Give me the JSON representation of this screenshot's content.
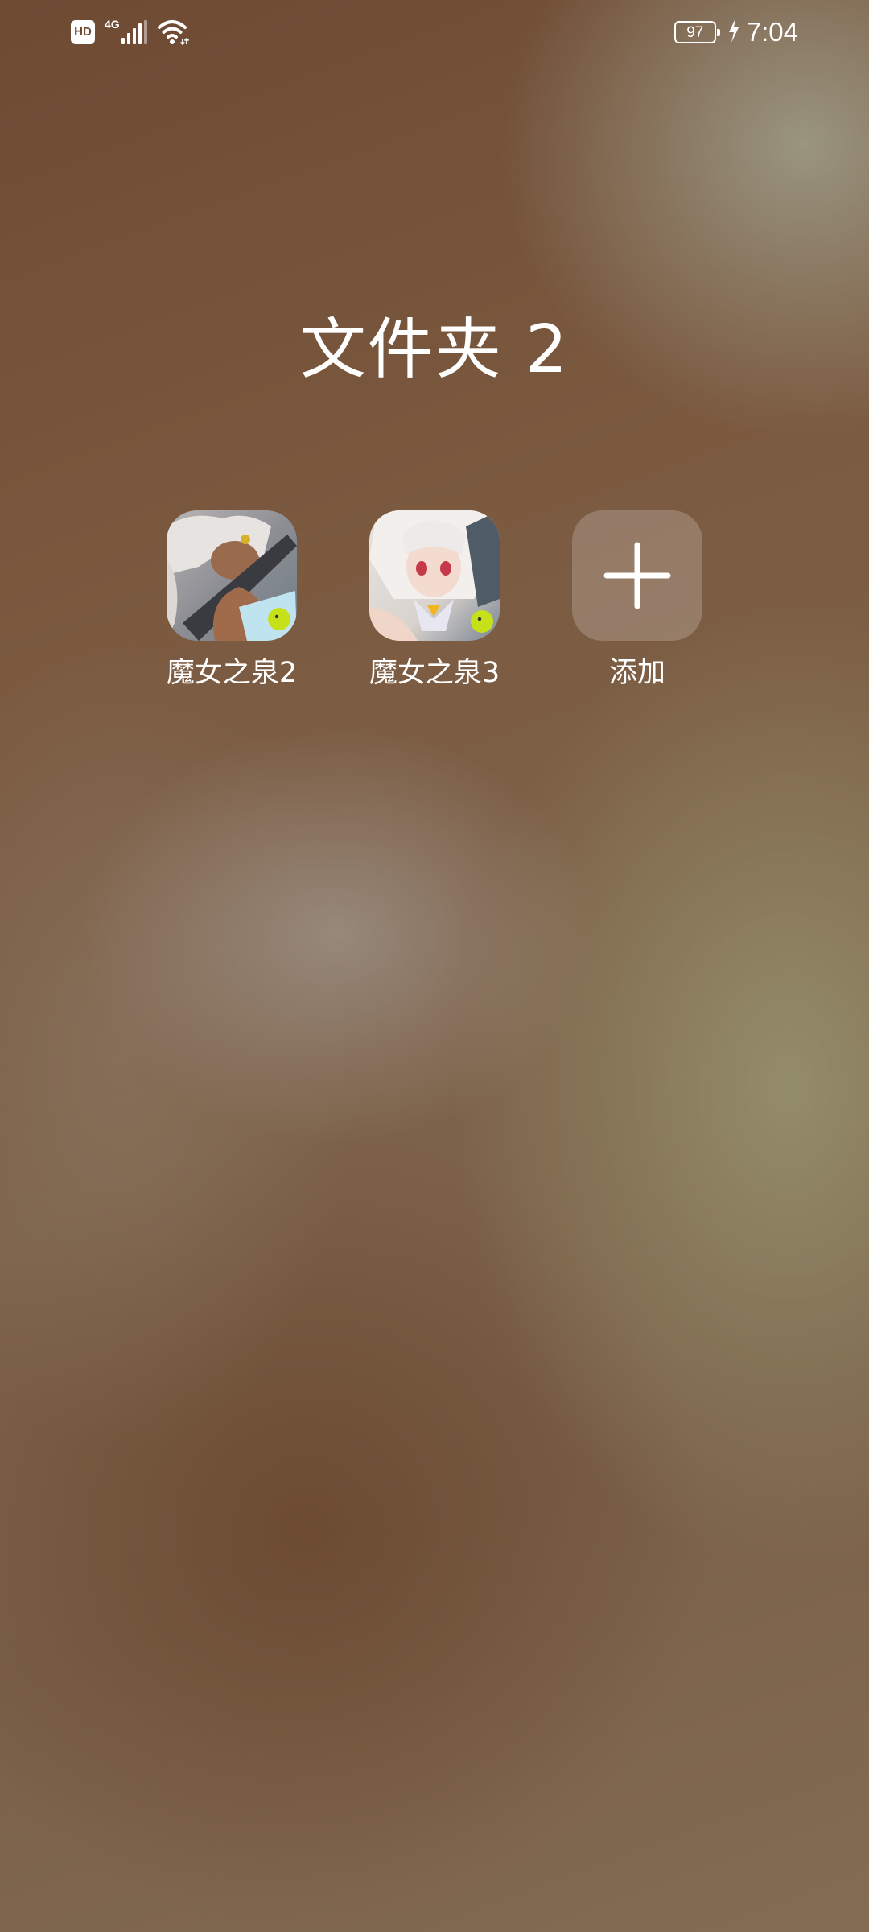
{
  "status_bar": {
    "hd_label": "HD",
    "network_type": "4G",
    "battery_level": "97",
    "time": "7:04",
    "icons": [
      "hd-icon",
      "signal-icon",
      "wifi-icon",
      "battery-icon",
      "charging-icon"
    ]
  },
  "folder": {
    "title": "文件夹 2",
    "apps": [
      {
        "label": "魔女之泉2",
        "icon": "game-icon-witch-spring-2"
      },
      {
        "label": "魔女之泉3",
        "icon": "game-icon-witch-spring-3"
      }
    ],
    "add_button": {
      "label": "添加",
      "icon": "plus-icon"
    }
  }
}
